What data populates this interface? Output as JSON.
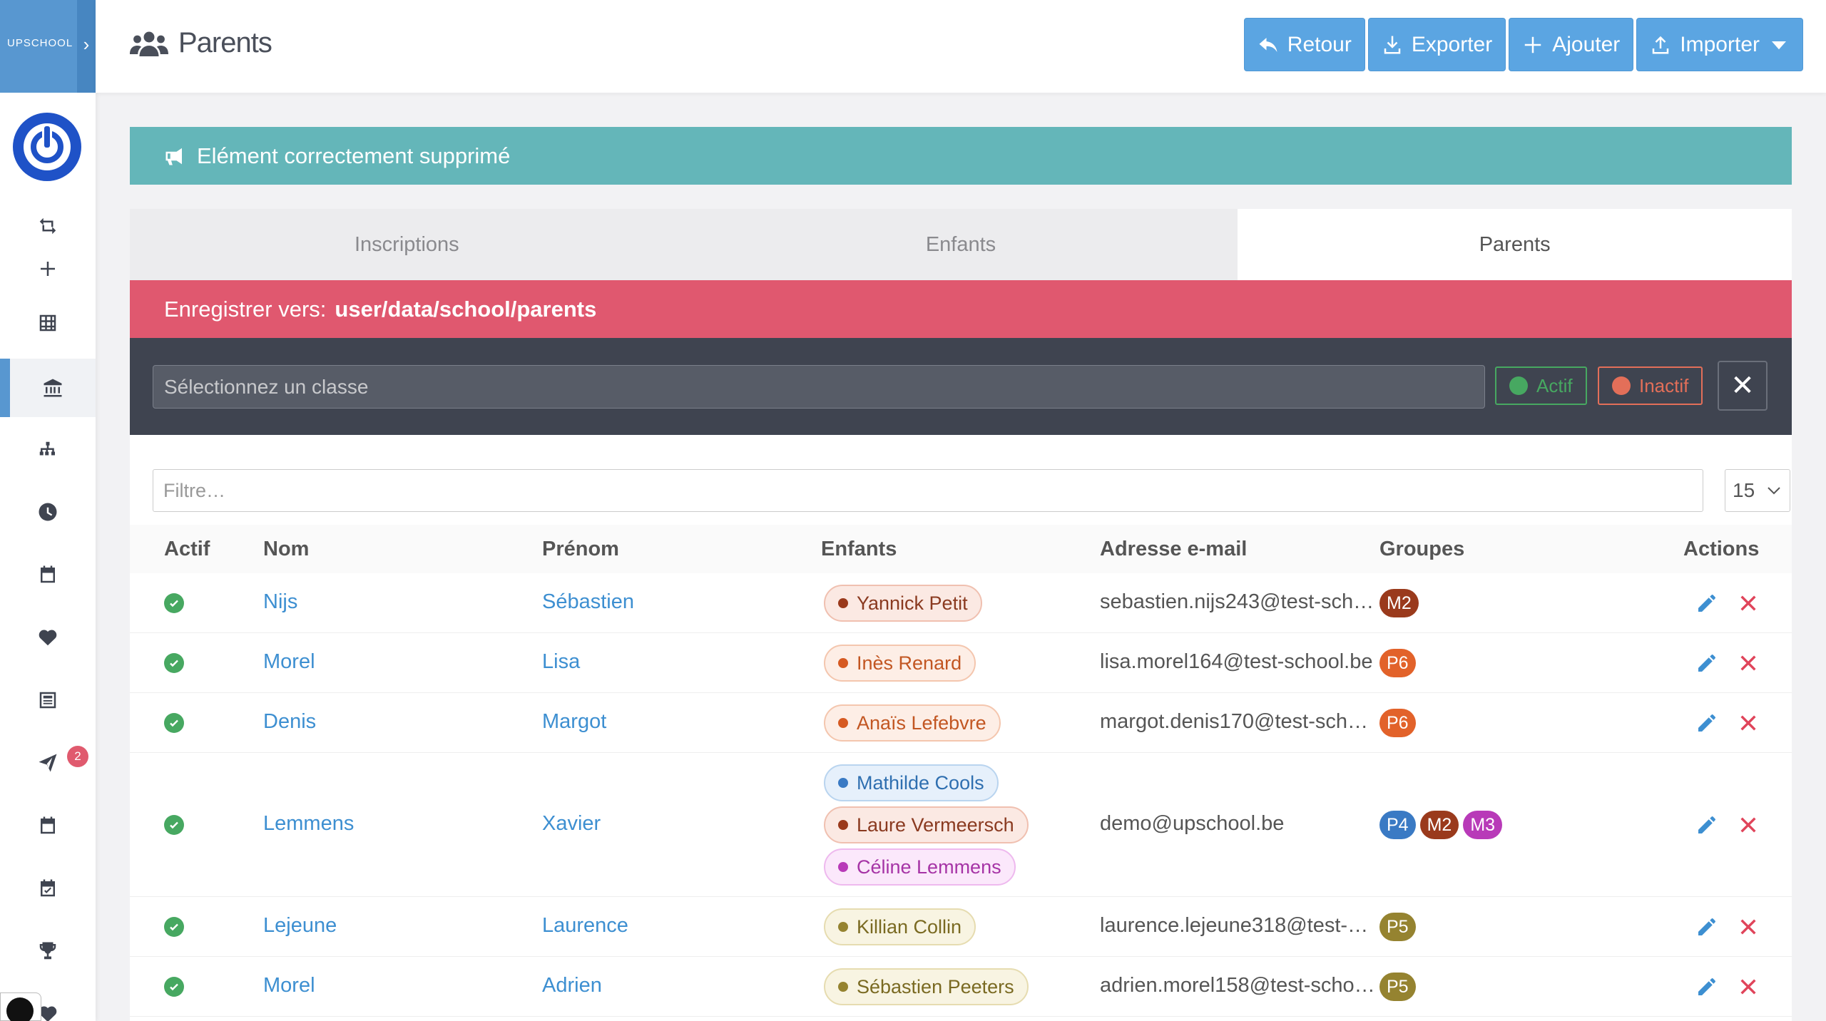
{
  "brand": {
    "name": "UPSCHOOL"
  },
  "header": {
    "title": "Parents",
    "buttons": {
      "back": "Retour",
      "export": "Exporter",
      "add": "Ajouter",
      "import": "Importer"
    }
  },
  "sidebar": {
    "messages_badge": "2"
  },
  "alert": {
    "message": "Elément correctement supprimé"
  },
  "tabs": [
    {
      "label": "Inscriptions",
      "active": false
    },
    {
      "label": "Enfants",
      "active": false
    },
    {
      "label": "Parents",
      "active": true
    }
  ],
  "save_bar": {
    "label": "Enregistrer vers:",
    "path": "user/data/school/parents"
  },
  "class_filter": {
    "placeholder": "Sélectionnez un classe",
    "active_label": "Actif",
    "inactive_label": "Inactif"
  },
  "table": {
    "filter_placeholder": "Filtre…",
    "per_page": "15",
    "columns": {
      "actif": "Actif",
      "nom": "Nom",
      "prenom": "Prénom",
      "enfants": "Enfants",
      "email": "Adresse e-mail",
      "groupes": "Groupes",
      "actions": "Actions"
    },
    "rows": [
      {
        "nom": "Nijs",
        "prenom": "Sébastien",
        "email": "sebastien.nijs243@test-sch…",
        "enfants": [
          {
            "name": "Yannick Petit",
            "color": "brown"
          }
        ],
        "groupes": [
          {
            "label": "M2",
            "color": "brown"
          }
        ]
      },
      {
        "nom": "Morel",
        "prenom": "Lisa",
        "email": "lisa.morel164@test-school.be",
        "enfants": [
          {
            "name": "Inès Renard",
            "color": "orange"
          }
        ],
        "groupes": [
          {
            "label": "P6",
            "color": "orange"
          }
        ]
      },
      {
        "nom": "Denis",
        "prenom": "Margot",
        "email": "margot.denis170@test-scho…",
        "enfants": [
          {
            "name": "Anaïs Lefebvre",
            "color": "orange"
          }
        ],
        "groupes": [
          {
            "label": "P6",
            "color": "orange"
          }
        ]
      },
      {
        "nom": "Lemmens",
        "prenom": "Xavier",
        "email": "demo@upschool.be",
        "enfants": [
          {
            "name": "Mathilde Cools",
            "color": "blue"
          },
          {
            "name": "Laure Vermeersch",
            "color": "brown"
          },
          {
            "name": "Céline Lemmens",
            "color": "purple"
          }
        ],
        "groupes": [
          {
            "label": "P4",
            "color": "blue"
          },
          {
            "label": "M2",
            "color": "brown"
          },
          {
            "label": "M3",
            "color": "purple"
          }
        ]
      },
      {
        "nom": "Lejeune",
        "prenom": "Laurence",
        "email": "laurence.lejeune318@test-s…",
        "enfants": [
          {
            "name": "Killian Collin",
            "color": "olive"
          }
        ],
        "groupes": [
          {
            "label": "P5",
            "color": "olive"
          }
        ]
      },
      {
        "nom": "Morel",
        "prenom": "Adrien",
        "email": "adrien.morel158@test-scho…",
        "enfants": [
          {
            "name": "Sébastien Peeters",
            "color": "olive"
          }
        ],
        "groupes": [
          {
            "label": "P5",
            "color": "olive"
          }
        ]
      }
    ]
  },
  "colors": {
    "primary": "#5ba5e2",
    "success": "#64b6b9",
    "danger": "#e0586f",
    "dark": "#3f4450",
    "link": "#3d8fd1"
  }
}
